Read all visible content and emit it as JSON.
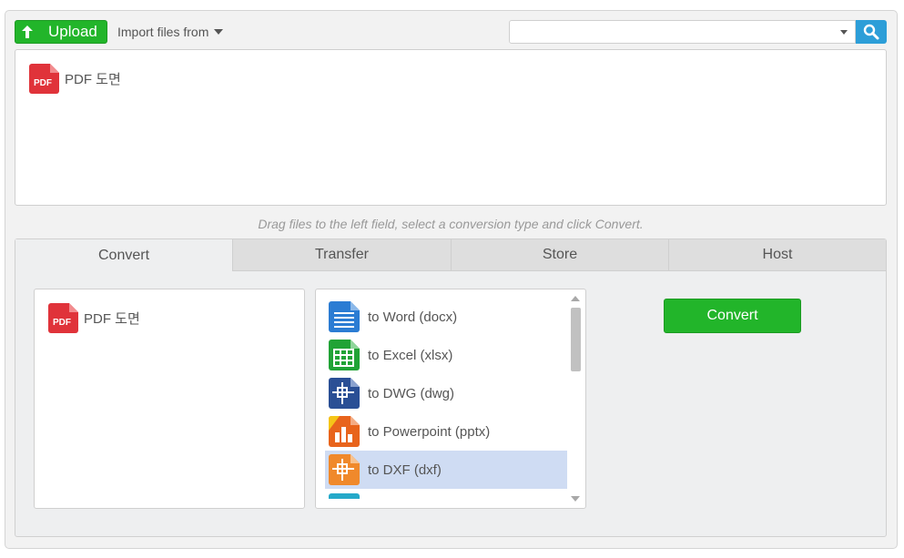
{
  "toolbar": {
    "upload_label": "Upload",
    "import_label": "Import files from",
    "search_value": ""
  },
  "drop_area": {
    "files": [
      {
        "name": "PDF 도면",
        "icon": "pdf-file-icon",
        "icon_text": "PDF"
      }
    ]
  },
  "hint": "Drag files to the left field, select a conversion type and click Convert.",
  "tabs": [
    {
      "label": "Convert",
      "active": true
    },
    {
      "label": "Transfer",
      "active": false
    },
    {
      "label": "Store",
      "active": false
    },
    {
      "label": "Host",
      "active": false
    }
  ],
  "convert_panel": {
    "selected_file": {
      "name": "PDF 도면",
      "icon_text": "PDF"
    },
    "conversions": [
      {
        "label": "to Word (docx)",
        "icon": "word-doc-icon",
        "color": "#2b7cd3"
      },
      {
        "label": "to Excel (xlsx)",
        "icon": "excel-sheet-icon",
        "color": "#21a336"
      },
      {
        "label": "to DWG (dwg)",
        "icon": "dwg-cad-icon",
        "color": "#2a4f95"
      },
      {
        "label": "to Powerpoint (pptx)",
        "icon": "powerpoint-chart-icon",
        "color": "#e8641c"
      },
      {
        "label": "to DXF (dxf)",
        "icon": "dxf-cad-icon",
        "color": "#f0892b",
        "selected": true
      }
    ],
    "convert_button": "Convert"
  },
  "colors": {
    "green": "#22b52a",
    "blue": "#2c9ed8",
    "pdf_red": "#e0333a",
    "selection": "#cfdcf3"
  }
}
